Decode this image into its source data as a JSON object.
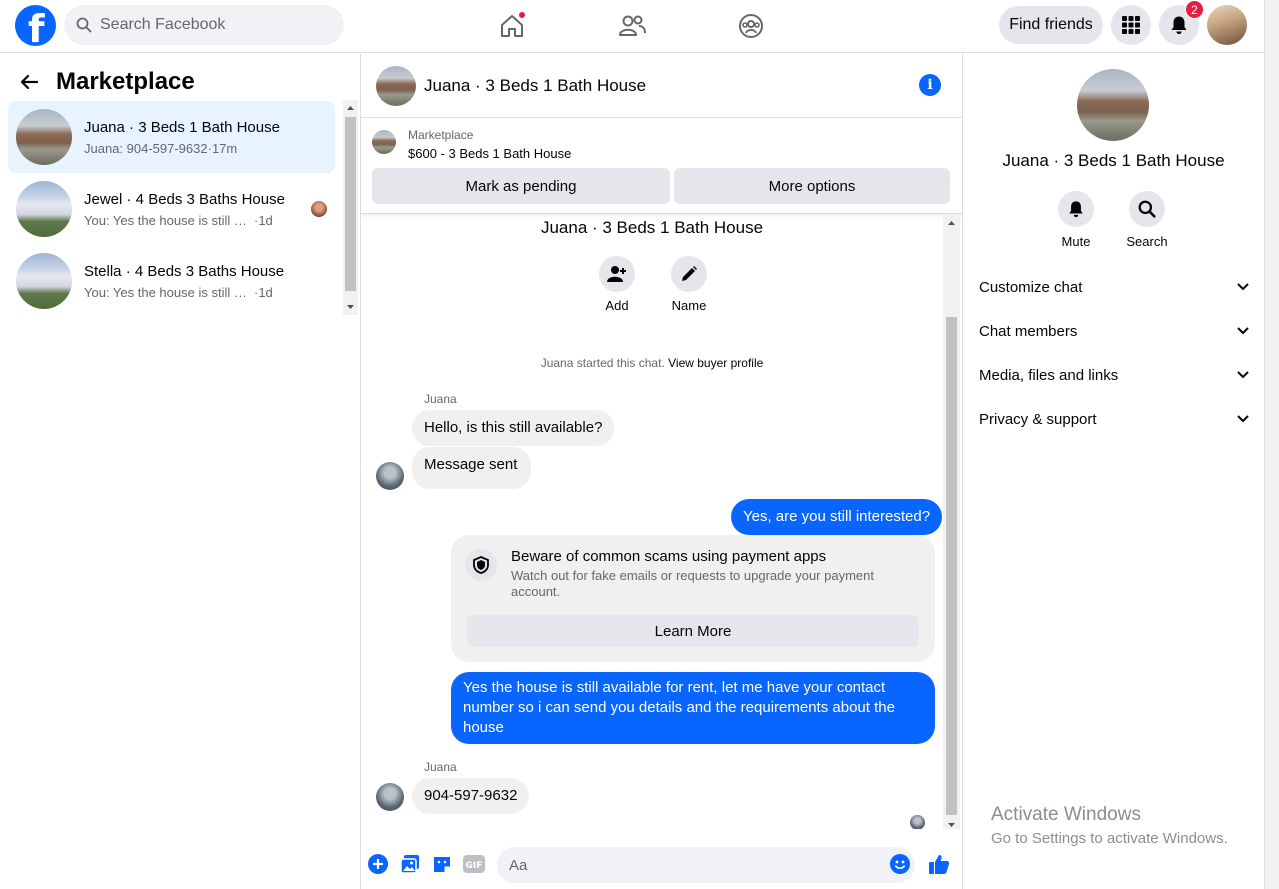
{
  "topbar": {
    "search_placeholder": "Search Facebook",
    "find_friends_label": "Find friends",
    "notification_count": "2",
    "nav_icons": [
      "home-icon",
      "friends-icon",
      "groups-icon"
    ],
    "accent_color": "#0866ff"
  },
  "left": {
    "title": "Marketplace",
    "conversations": [
      {
        "title": "Juana · 3 Beds 1 Bath House",
        "preview": "Juana: 904-597-9632",
        "time": "·17m",
        "active": true
      },
      {
        "title": "Jewel · 4 Beds 3 Baths House",
        "preview": "You: Yes the house is still availab...",
        "time": "·1d",
        "active": false
      },
      {
        "title": "Stella · 4 Beds 3 Baths House",
        "preview": "You: Yes the house is still available ...",
        "time": "·1d",
        "active": false
      }
    ]
  },
  "chat": {
    "header_title": "Juana · 3 Beds 1 Bath House",
    "listing_source": "Marketplace",
    "listing_price_title": "$600 - 3 Beds 1 Bath House",
    "mark_pending_label": "Mark as pending",
    "more_options_label": "More options",
    "intro_title": "Juana · 3 Beds 1 Bath House",
    "add_label": "Add",
    "name_label": "Name",
    "system_text": "Juana started this chat.",
    "system_link": "View buyer profile",
    "messages": [
      {
        "sender": "Juana",
        "text": "Hello, is this still available?",
        "dir": "in"
      },
      {
        "sender": "",
        "text": "Message sent",
        "dir": "in"
      },
      {
        "sender": "",
        "text": "Yes, are you still interested?",
        "dir": "out"
      },
      {
        "sender": "",
        "text": "Yes the house is still available for rent, let me have your contact number so i can send you details and the requirements about the house",
        "dir": "out"
      },
      {
        "sender": "Juana",
        "text": "904-597-9632",
        "dir": "in"
      }
    ],
    "scam_notice": {
      "title": "Beware of common scams using payment apps",
      "body": "Watch out for fake emails or requests to upgrade your payment account.",
      "button": "Learn More"
    },
    "composer_placeholder": "Aa"
  },
  "right": {
    "name": "Juana · 3 Beds 1 Bath House",
    "mute_label": "Mute",
    "search_label": "Search",
    "sections": [
      "Customize chat",
      "Chat members",
      "Media, files and links",
      "Privacy & support"
    ]
  },
  "watermark": {
    "line1": "Activate Windows",
    "line2": "Go to Settings to activate Windows."
  }
}
